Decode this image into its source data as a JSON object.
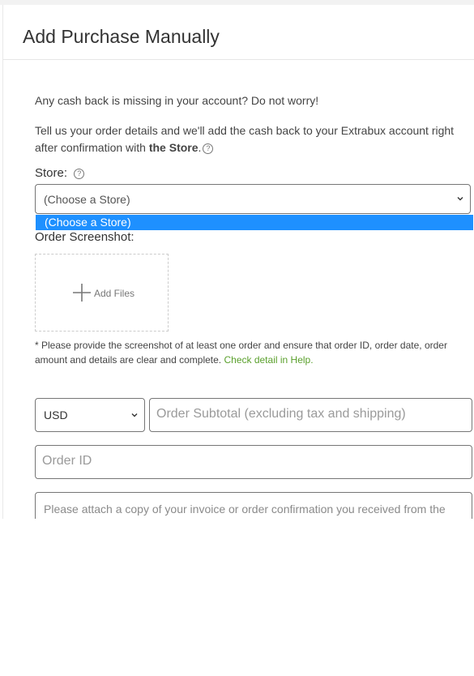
{
  "header": {
    "title": "Add Purchase Manually"
  },
  "intro": {
    "line1": "Any cash back is missing in your account? Do not worry!",
    "line2_prefix": "Tell us your order details and we'll add the cash back to your Extrabux account right after confirmation with ",
    "line2_store": "the Store",
    "line2_suffix": "."
  },
  "store": {
    "label": "Store:",
    "selected": "(Choose a Store)",
    "options": [
      "(Choose a Store)"
    ]
  },
  "screenshot": {
    "label": "Order Screenshot:",
    "add_files": "Add Files"
  },
  "note": {
    "text": "* Please provide the screenshot of at least one order and ensure that order ID, order date, order amount and details are clear and complete. ",
    "link": "Check detail in Help."
  },
  "currency": {
    "selected": "USD"
  },
  "subtotal": {
    "placeholder": "Order Subtotal (excluding tax and shipping)"
  },
  "order_id": {
    "placeholder": "Order ID"
  },
  "invoice": {
    "placeholder": "Please attach a copy of your invoice or order confirmation you received from the store here."
  },
  "help_glyph": "?"
}
